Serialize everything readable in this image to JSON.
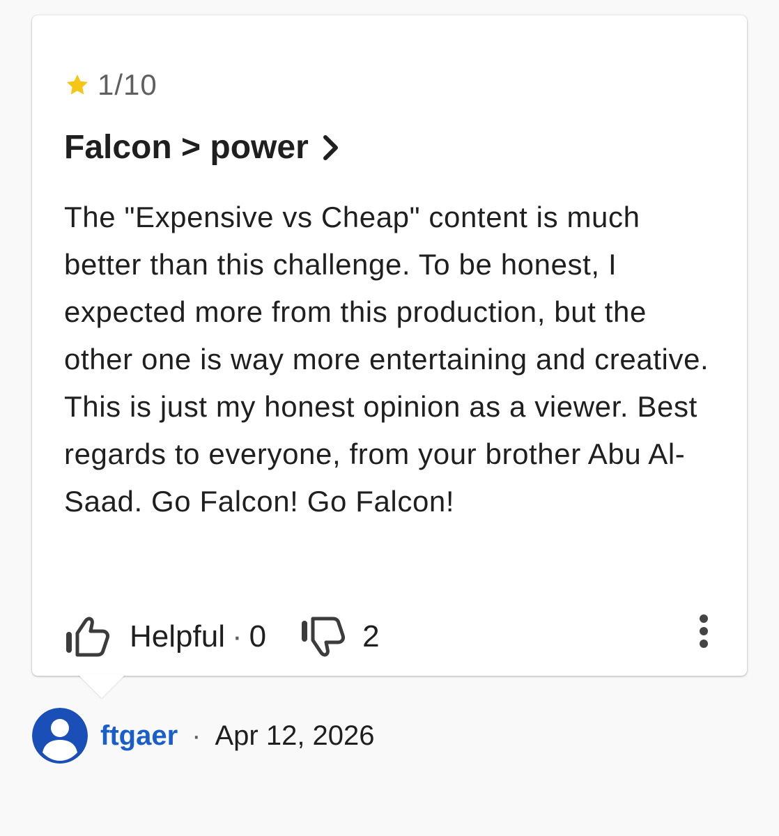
{
  "review": {
    "rating_text": "1/10",
    "title": "Falcon > power",
    "body": "The \"Expensive vs Cheap\" content is much better than this challenge. To be honest, I expected more from this production, but the other one is way more entertaining and creative. This is just my honest opinion as a viewer. Best regards to everyone, from your brother Abu Al-Saad. Go Falcon! Go Falcon!",
    "helpful_label": "Helpful",
    "separator": "·",
    "helpful_count": "0",
    "not_helpful_count": "2"
  },
  "author": {
    "name": "ftgaer",
    "separator": "·",
    "date": "Apr 12, 2026"
  },
  "icons": {
    "star": "star-icon",
    "chevron": "chevron-right-icon",
    "thumbs_up": "thumbs-up-icon",
    "thumbs_down": "thumbs-down-icon",
    "more": "more-vert-icon",
    "avatar": "person-icon"
  },
  "colors": {
    "star": "#f5c518",
    "link": "#1a5fc9",
    "avatar_bg": "#1a4fb8"
  }
}
